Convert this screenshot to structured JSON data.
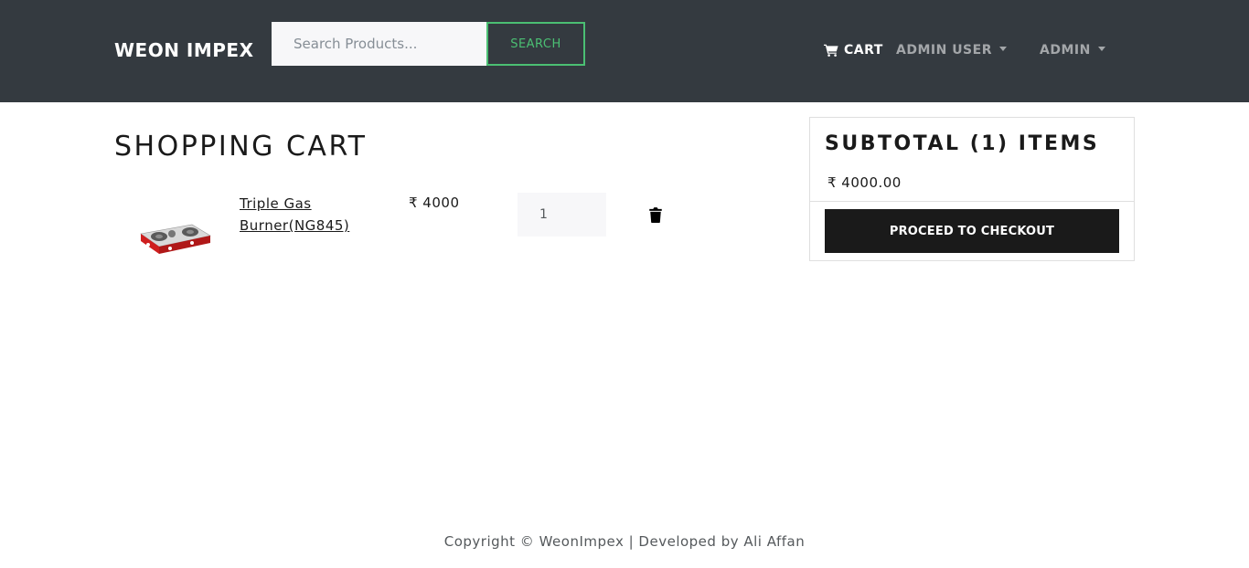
{
  "header": {
    "brand": "WEON IMPEX",
    "search": {
      "placeholder": "Search Products...",
      "value": ""
    },
    "search_button": "SEARCH",
    "nav": {
      "cart": "CART",
      "admin_user": "ADMIN USER",
      "admin": "ADMIN"
    }
  },
  "main": {
    "title": "SHOPPING CART",
    "items": [
      {
        "name": "Triple Gas Burner(NG845)",
        "price": "₹ 4000",
        "quantity": "1"
      }
    ]
  },
  "summary": {
    "title": "SUBTOTAL (1) ITEMS",
    "total": "₹ 4000.00",
    "checkout_button": "PROCEED TO CHECKOUT"
  },
  "footer": {
    "text": "Copyright © WeonImpex | Developed by Ali Affan"
  },
  "colors": {
    "navbar": "#343a40",
    "accent": "#4bbf73",
    "checkout": "#1a1a1a"
  },
  "icons": [
    "cart-icon",
    "trash-icon",
    "caret-down-icon"
  ]
}
